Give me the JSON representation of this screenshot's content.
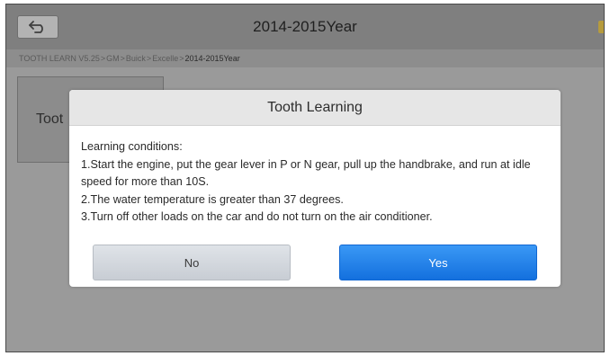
{
  "header": {
    "title": "2014-2015Year",
    "back_icon": "back-arrow-icon"
  },
  "breadcrumb": {
    "items": [
      "TOOTH LEARN V5.25",
      "GM",
      "Buick",
      "Excelle"
    ],
    "separator": ">",
    "current": "2014-2015Year"
  },
  "main": {
    "tile_label": "Toot"
  },
  "dialog": {
    "title": "Tooth Learning",
    "lines": [
      "Learning conditions:",
      "1.Start the engine, put the gear lever in P or N gear, pull up the handbrake, and run at idle speed for more than 10S.",
      "2.The water temperature is greater than 37 degrees.",
      "3.Turn off other loads on the car and do not turn on the air conditioner."
    ],
    "no_label": "No",
    "yes_label": "Yes"
  },
  "colors": {
    "yes_button": "#1f80ea",
    "no_button": "#d3d7dd",
    "overlay_gray": "#9a9a9a"
  }
}
